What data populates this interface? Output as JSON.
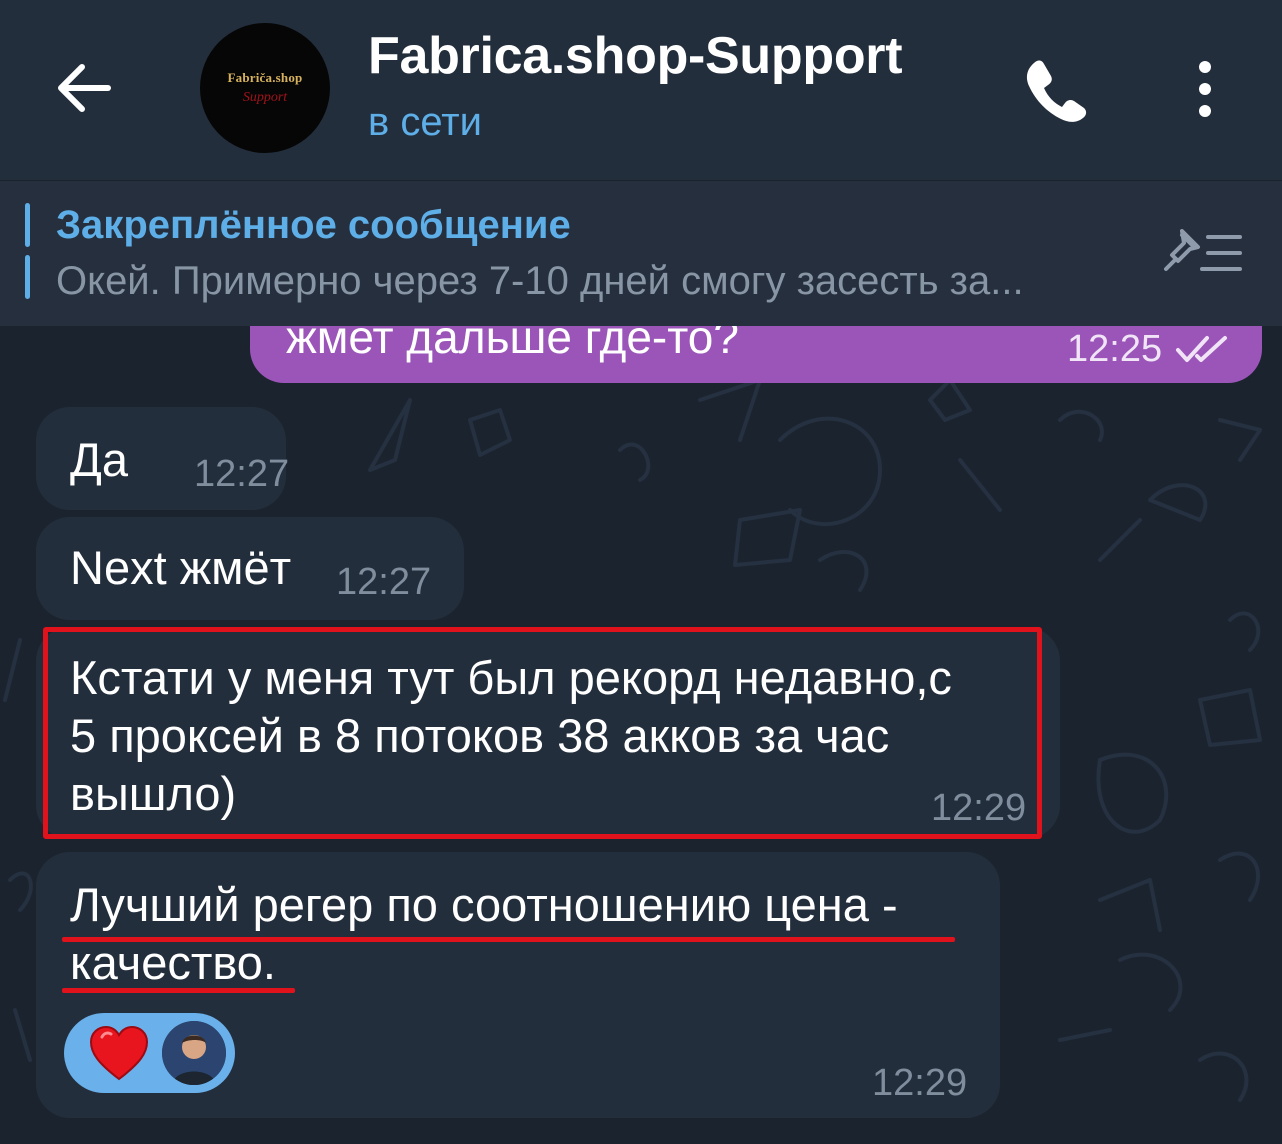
{
  "header": {
    "back_icon": "arrow-left-icon",
    "avatar_brand": "Fabriča.shop",
    "avatar_sub": "Support",
    "title": "Fabrica.shop-Support",
    "status": "в сети",
    "call_icon": "phone-icon",
    "menu_icon": "more-vertical-icon"
  },
  "pinned": {
    "title": "Закреплённое сообщение",
    "text": "Окей. Примерно через 7-10 дней смогу засесть за...",
    "icon": "pin-list-icon"
  },
  "messages": [
    {
      "direction": "out",
      "text": "жмет дальше где-то?",
      "time": "12:25",
      "status_icon": "double-check-icon"
    },
    {
      "direction": "in",
      "text": "Да",
      "time": "12:27"
    },
    {
      "direction": "in",
      "text": "Next жмёт",
      "time": "12:27"
    },
    {
      "direction": "in",
      "lines": [
        "Кстати у меня тут был рекорд недавно,с",
        "5 проксей в 8 потоков 38 акков за час",
        "вышло)"
      ],
      "time": "12:29",
      "highlighted": true
    },
    {
      "direction": "in",
      "lines": [
        "Лучший регер по соотношению цена -",
        "качество."
      ],
      "time": "12:29",
      "underlined": true,
      "reaction": {
        "emoji": "❤",
        "icon": "heart-icon"
      }
    }
  ],
  "colors": {
    "accent": "#5eaee8",
    "outgoing_bubble": "#9b55b8",
    "incoming_bubble": "#232e3c",
    "annotation_red": "#e0121b"
  }
}
